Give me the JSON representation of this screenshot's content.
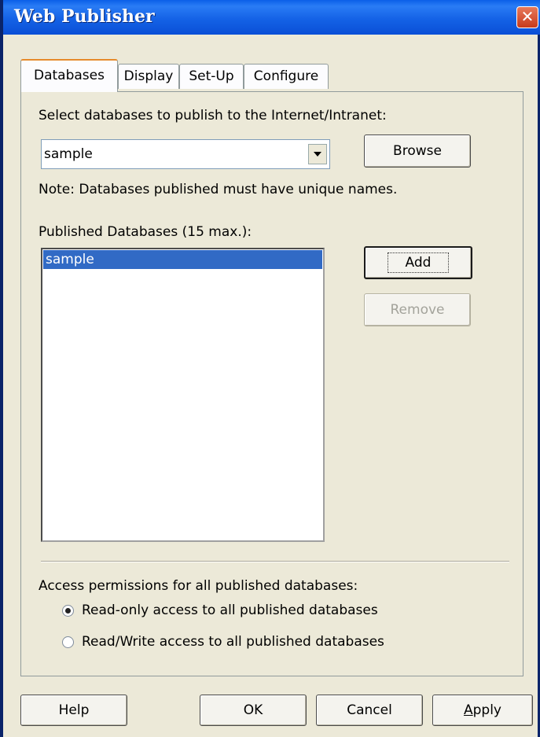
{
  "window": {
    "title": "Web Publisher"
  },
  "tabs": [
    {
      "label": "Databases",
      "active": true
    },
    {
      "label": "Display",
      "active": false
    },
    {
      "label": "Set-Up",
      "active": false
    },
    {
      "label": "Configure",
      "active": false
    }
  ],
  "databases": {
    "select_label": "Select databases to publish to the Internet/Intranet:",
    "combo_value": "sample",
    "browse_label": "Browse",
    "note": "Note: Databases published must have unique names.",
    "published_label": "Published Databases (15 max.):",
    "published_items": [
      "sample"
    ],
    "selected_item": "sample",
    "add_label": "Add",
    "remove_label": "Remove",
    "remove_enabled": false
  },
  "permissions": {
    "label": "Access permissions for all published databases:",
    "options": [
      {
        "label": "Read-only access to all published databases",
        "checked": true
      },
      {
        "label": "Read/Write access to all published databases",
        "checked": false
      }
    ]
  },
  "footer": {
    "help_label": "Help",
    "ok_label": "OK",
    "cancel_label": "Cancel",
    "apply_label": "Apply",
    "apply_mnemonic": "A"
  },
  "colors": {
    "titlebar": "#0a5fe8",
    "selection": "#316ac5",
    "dialog_bg": "#ece9d8",
    "close_button": "#c63a1c"
  },
  "icons": {
    "close": "close-icon",
    "dropdown": "chevron-down-icon"
  }
}
